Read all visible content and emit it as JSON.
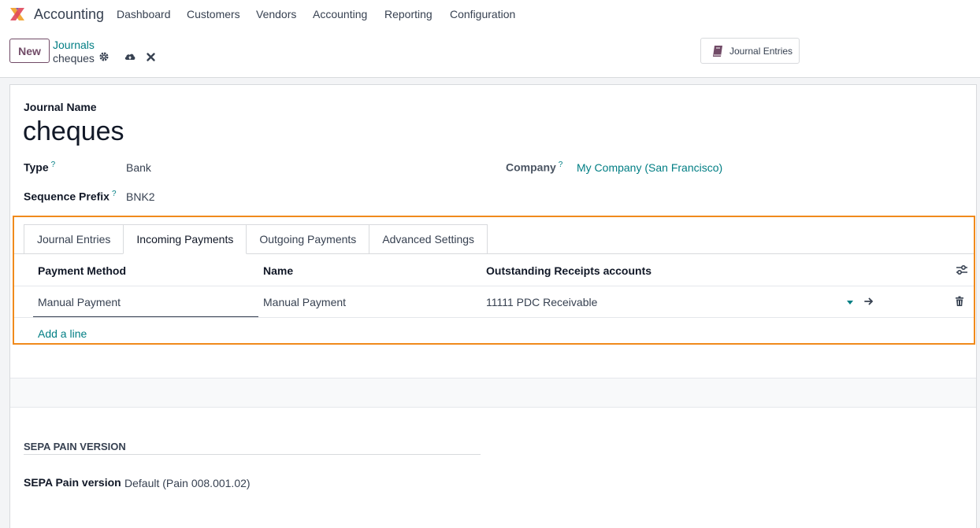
{
  "topbar": {
    "app_name": "Accounting",
    "nav": [
      "Dashboard",
      "Customers",
      "Vendors",
      "Accounting",
      "Reporting",
      "Configuration"
    ]
  },
  "control": {
    "new_label": "New",
    "breadcrumb_parent": "Journals",
    "breadcrumb_current": "cheques",
    "journal_entries_button": "Journal Entries"
  },
  "form": {
    "journal_name_label": "Journal Name",
    "journal_name": "cheques",
    "type_label": "Type",
    "type_value": "Bank",
    "help_mark": "?",
    "sequence_label": "Sequence Prefix",
    "sequence_value": "BNK2",
    "company_label": "Company",
    "company_value": "My Company (San Francisco)"
  },
  "tabs": [
    "Journal Entries",
    "Incoming Payments",
    "Outgoing Payments",
    "Advanced Settings"
  ],
  "active_tab": "Incoming Payments",
  "table": {
    "headers": [
      "Payment Method",
      "Name",
      "Outstanding Receipts accounts"
    ],
    "rows": [
      {
        "payment_method": "Manual Payment",
        "name": "Manual Payment",
        "account": "11111 PDC Receivable"
      }
    ],
    "add_line": "Add a line"
  },
  "sepa": {
    "section_title": "SEPA PAIN VERSION",
    "label": "SEPA Pain version",
    "value": "Default (Pain 008.001.02)"
  },
  "colors": {
    "brand": "#714b67",
    "link": "#017e84",
    "highlight": "#f08a1c"
  }
}
